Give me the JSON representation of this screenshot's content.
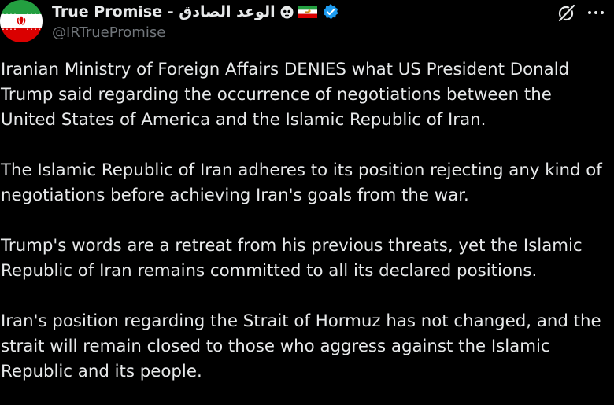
{
  "post": {
    "author": {
      "display_name": "True Promise - الوعد الصادق",
      "handle": "@IRTruePromise",
      "avatar_icon": "iran-flag-avatar",
      "name_emojis": [
        "skull-icon",
        "iran-lion-sun-flag-icon"
      ],
      "verified_icon": "verified-badge-icon",
      "verified_color": "#1d9bf0"
    },
    "actions": {
      "grok_icon": "grok-icon",
      "more_icon": "more-options-icon"
    },
    "paragraphs": [
      "Iranian Ministry of Foreign Affairs DENIES what US President Donald Trump said regarding the occurrence of negotiations between the United States of America and the Islamic Republic of Iran.",
      "The Islamic Republic of Iran adheres to its position rejecting any kind of negotiations before achieving Iran's goals from the war.",
      "Trump's words are a retreat from his previous threats, yet the Islamic Republic of Iran remains committed to all its declared positions.",
      "Iran's position regarding the Strait of Hormuz has not changed, and the strait will remain closed to those who aggress against the Islamic Republic and its people."
    ],
    "colors": {
      "background": "#000000",
      "text": "#e7e9ea",
      "secondary": "#71767b",
      "flag_green": "#239f40",
      "flag_white": "#ffffff",
      "flag_red": "#da0000"
    }
  }
}
